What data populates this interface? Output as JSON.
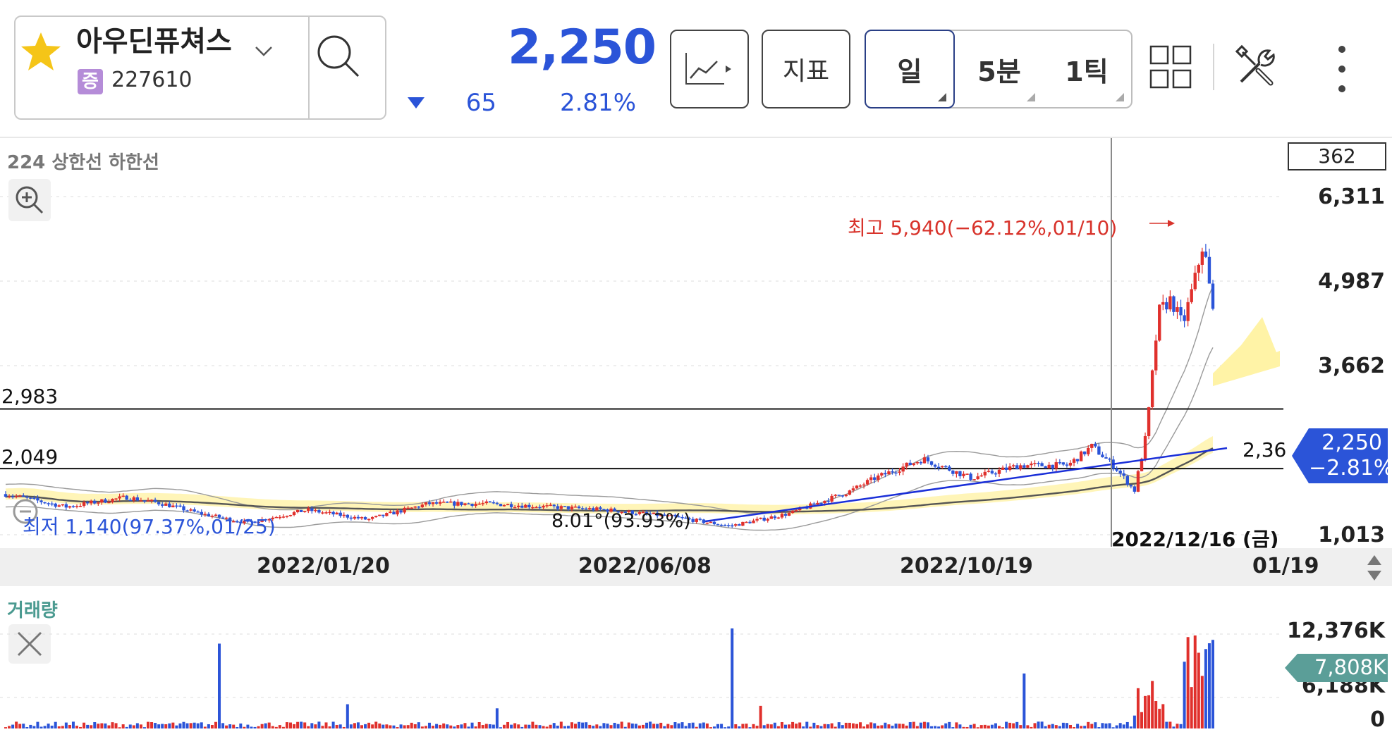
{
  "header": {
    "stock_name": "아우딘퓨쳐스",
    "market_badge": "증",
    "stock_code": "227610",
    "price": "2,250",
    "change": "65",
    "change_pct": "2.81%",
    "chart_type_button": "chart-line-icon",
    "indicator_button": "지표",
    "periods": [
      "일",
      "5분",
      "1틱"
    ],
    "active_period": "일",
    "icons": [
      "star-icon",
      "chevron-down-icon",
      "search-icon",
      "grid-layout-icon",
      "tools-icon",
      "more-vertical-icon"
    ]
  },
  "chart": {
    "indicator_label": "224 상한선 하한선",
    "count_box": "362",
    "y_ticks": [
      "6,311",
      "4,987",
      "3,662",
      "1,013"
    ],
    "hlines": [
      {
        "label": "2,983",
        "price": 2983
      },
      {
        "label": "2,049",
        "price": 2049
      }
    ],
    "trendline_label": "2,36",
    "high_annotation": "최고 5,940(−62.12%,01/10)",
    "low_annotation": "최저 1,140(97.37%,01/25)",
    "angle_annotation": "8.01°(93.93%)",
    "crosshair_date": "2022/12/16 (금)",
    "price_tag": {
      "price": "2,250",
      "pct": "−2.81%"
    },
    "x_labels": [
      "2022/01/20",
      "2022/06/08",
      "2022/10/19",
      "01/19"
    ]
  },
  "volume": {
    "label": "거래량",
    "y_ticks": [
      "12,376K",
      "6,188K",
      "0"
    ],
    "tag": "7,808K"
  },
  "colors": {
    "accent_blue": "#2b54d8",
    "up_red": "#e0302c",
    "down_blue": "#2b54d8",
    "cloud_yellow": "#fff3a6",
    "volume_teal": "#5b9e98"
  },
  "chart_data": {
    "type": "candlestick",
    "x_labels": [
      "2022/01/20",
      "2022/06/08",
      "2022/10/19",
      "01/19"
    ],
    "ylim": [
      1013,
      6311
    ],
    "y_ticks": [
      6311,
      4987,
      3662,
      1013
    ],
    "horizontal_lines": [
      2983,
      2049
    ],
    "last_price": 2250,
    "high": 5940,
    "low": 1140,
    "grid": true,
    "volume_ylim": [
      0,
      12376
    ],
    "volume_last": 7808
  }
}
